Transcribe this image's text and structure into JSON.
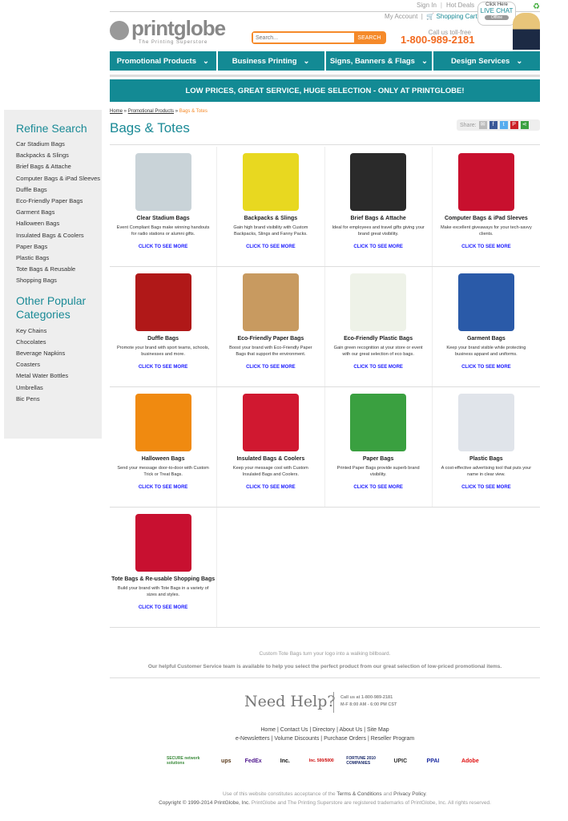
{
  "header": {
    "sign_in": "Sign In",
    "hot_deals": "Hot Deals",
    "my_account": "My Account",
    "shopping_cart": "Shopping Cart",
    "logo_text": "printglobe",
    "logo_tagline": "The Printing Superstore",
    "search_placeholder": "Search...",
    "search_button": "SEARCH",
    "call_label": "Call us toll-free",
    "phone": "1-800-989-2181",
    "chat_click": "Click Here",
    "chat_live": "LIVE CHAT",
    "chat_status": "Offline"
  },
  "nav": [
    "Promotional Products",
    "Business Printing",
    "Signs, Banners & Flags",
    "Design Services"
  ],
  "banner": "LOW PRICES, GREAT SERVICE, HUGE SELECTION - ONLY AT PRINTGLOBE!",
  "sidebar": {
    "refine_title": "Refine Search",
    "refine": [
      "Car Stadium Bags",
      "Backpacks & Slings",
      "Brief Bags & Attache",
      "Computer Bags & iPad Sleeves",
      "Duffle Bags",
      "Eco-Friendly Paper Bags",
      "Garment Bags",
      "Halloween Bags",
      "Insulated Bags & Coolers",
      "Paper Bags",
      "Plastic Bags",
      "Tote Bags & Reusable Shopping Bags"
    ],
    "other_title": "Other Popular Categories",
    "other": [
      "Key Chains",
      "Chocolates",
      "Beverage Napkins",
      "Coasters",
      "Metal Water Bottles",
      "Umbrellas",
      "Bic Pens"
    ]
  },
  "breadcrumb": [
    "Home",
    "Promotional Products",
    "Bags & Totes"
  ],
  "page_title": "Bags & Totes",
  "share_label": "Share:",
  "cta": "CLICK TO SEE MORE",
  "products": [
    {
      "name": "Clear Stadium Bags",
      "desc": "Event Compliant Bags make winning handouts for radio stations or alumni gifts.",
      "color": "#c9d3d8"
    },
    {
      "name": "Backpacks & Slings",
      "desc": "Gain high brand visibility with Custom Backpacks, Slings and Fanny Packs.",
      "color": "#e8d820"
    },
    {
      "name": "Brief Bags & Attache",
      "desc": "Ideal for employees and travel gifts giving your brand great visibility.",
      "color": "#2a2a2a"
    },
    {
      "name": "Computer Bags & iPad Sleeves",
      "desc": "Make excellent giveaways for your tech-savvy clients.",
      "color": "#c8102e"
    },
    {
      "name": "Duffle Bags",
      "desc": "Promote your brand with sport teams, schools, businesses and more.",
      "color": "#b01818"
    },
    {
      "name": "Eco-Friendly Paper Bags",
      "desc": "Boost your brand with Eco-Friendly Paper Bags that support the environment.",
      "color": "#c89a60"
    },
    {
      "name": "Eco-Friendly Plastic Bags",
      "desc": "Gain green recognition at your store or event with our great selection of eco bags.",
      "color": "#eef2e8"
    },
    {
      "name": "Garment Bags",
      "desc": "Keep your brand visible while protecting business apparel and uniforms.",
      "color": "#2a5aa8"
    },
    {
      "name": "Halloween Bags",
      "desc": "Send your message door-to-door with Custom Trick or Treat Bags.",
      "color": "#f08a10"
    },
    {
      "name": "Insulated Bags & Coolers",
      "desc": "Keep your message cool with Custom Insulated Bags and Coolers.",
      "color": "#d01830"
    },
    {
      "name": "Paper Bags",
      "desc": "Printed Paper Bags provide superb brand visibility.",
      "color": "#3aa040"
    },
    {
      "name": "Plastic Bags",
      "desc": "A cost-effective advertising tool that puts your name in clear view.",
      "color": "#e0e4ea"
    },
    {
      "name": "Tote Bags & Re-usable Shopping Bags",
      "desc": "Build your brand with Tote Bags in a variety of sizes and styles.",
      "color": "#c81030"
    }
  ],
  "footer": {
    "tagline": "Custom Tote Bags turn your logo into a walking billboard.",
    "service": "Our helpful Customer Service team is available to help you select the perfect product from our great selection of low-priced promotional items.",
    "need_help": "Need Help?",
    "call_line": "Call us at 1-800-989-2181",
    "hours": "M-F 8:00 AM - 6:00 PM CST",
    "links1": [
      "Home",
      "Contact Us",
      "Directory",
      "About Us",
      "Site Map"
    ],
    "links2": [
      "e-Newsletters",
      "Volume Discounts",
      "Purchase Orders",
      "Reseller Program"
    ],
    "badges": [
      "SECURE network solutions",
      "ups",
      "FedEx",
      "Inc.",
      "Inc. 500/5000",
      "FORTUNE 2010 COMPANIES",
      "UPIC",
      "PPAI",
      "Adobe"
    ],
    "legal_prefix": "Use of this website constitutes acceptance of the",
    "terms": "Terms & Conditions",
    "and": "and",
    "privacy": "Privacy Policy",
    "copyright": "Copyright © 1999-2014",
    "company": "PrintGlobe, Inc.",
    "trademark": "PrintGlobe and The Printing Superstore are registered trademarks of PrintGlobe, Inc. All rights reserved."
  }
}
